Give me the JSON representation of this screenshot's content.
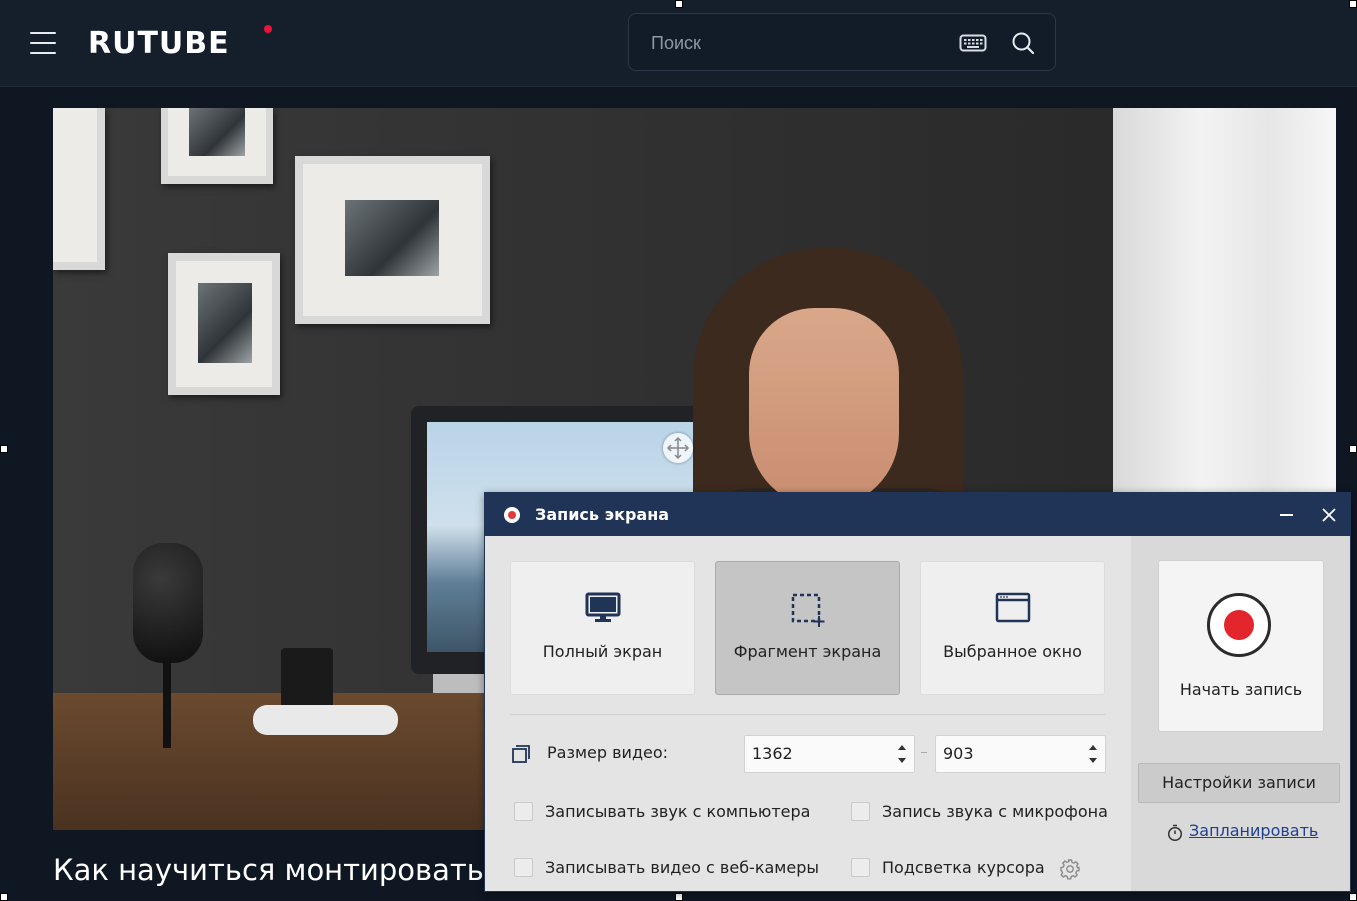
{
  "site": {
    "logo": "RUTUBE",
    "menu_icon": "hamburger-icon",
    "search": {
      "placeholder": "Поиск",
      "keyboard_icon": "keyboard-icon",
      "search_icon": "search-icon"
    }
  },
  "video": {
    "title": "Как научиться монтировать?"
  },
  "recorder": {
    "title": "Запись экрана",
    "minimize_icon": "minimize-icon",
    "close_icon": "close-icon",
    "modes": [
      {
        "label": "Полный экран",
        "icon": "monitor-icon",
        "active": false
      },
      {
        "label": "Фрагмент экрана",
        "icon": "selection-icon",
        "active": true
      },
      {
        "label": "Выбранное окно",
        "icon": "window-icon",
        "active": false
      }
    ],
    "video_size": {
      "label": "Размер видео:",
      "width": "1362",
      "height": "903"
    },
    "options": [
      {
        "label": "Записывать звук с компьютера",
        "checked": false
      },
      {
        "label": "Запись звука с микрофона",
        "checked": false
      },
      {
        "label": "Записывать видео с веб-камеры",
        "checked": false
      },
      {
        "label": "Подсветка курсора",
        "checked": false
      }
    ],
    "start_label": "Начать запись",
    "settings_label": "Настройки записи",
    "schedule_label": "Запланировать"
  },
  "colors": {
    "header_bg": "#151f2c",
    "recorder_titlebar": "#203458",
    "record_red": "#e3262b",
    "logo_dot": "#ed143b"
  }
}
